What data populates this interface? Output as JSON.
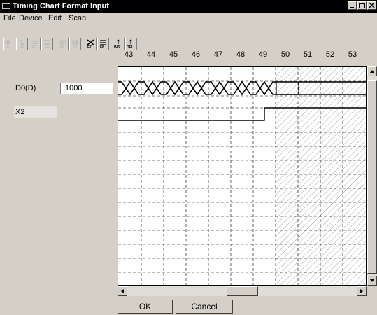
{
  "window": {
    "title": "Timing Chart Format Input"
  },
  "menu": {
    "file": "File",
    "device": "Device",
    "edit": "Edit",
    "scan": "Scan"
  },
  "toolbar": {
    "buttons": [
      {
        "name": "f1-button",
        "enabled": false
      },
      {
        "name": "f2-button",
        "enabled": false
      },
      {
        "name": "f3-button",
        "enabled": false
      },
      {
        "name": "f4-button",
        "enabled": false
      },
      {
        "name": "f5-button",
        "enabled": false
      },
      {
        "name": "f6-button",
        "enabled": false
      },
      {
        "name": "f7-button",
        "enabled": true
      },
      {
        "name": "f8-button",
        "enabled": true
      },
      {
        "name": "ins-button",
        "enabled": true
      },
      {
        "name": "del-button",
        "enabled": true
      }
    ]
  },
  "columns": [
    "43",
    "44",
    "45",
    "46",
    "47",
    "48",
    "49",
    "50",
    "51",
    "52",
    "53"
  ],
  "devices": [
    {
      "label": "D0(D)",
      "value": "1000"
    },
    {
      "label": "X2",
      "value": ""
    }
  ],
  "buttons": {
    "ok": "OK",
    "cancel": "Cancel"
  }
}
